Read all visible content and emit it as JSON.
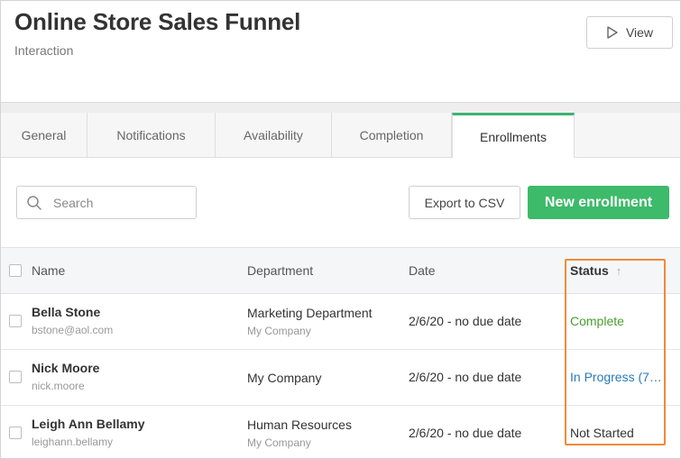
{
  "header": {
    "title": "Online Store Sales Funnel",
    "subtitle": "Interaction",
    "view_label": "View"
  },
  "tabs": [
    {
      "label": "General"
    },
    {
      "label": "Notifications"
    },
    {
      "label": "Availability"
    },
    {
      "label": "Completion"
    },
    {
      "label": "Enrollments",
      "active": true
    }
  ],
  "toolbar": {
    "search_placeholder": "Search",
    "export_label": "Export to CSV",
    "new_label": "New enrollment"
  },
  "table": {
    "columns": {
      "name": "Name",
      "department": "Department",
      "date": "Date",
      "status": "Status",
      "status_sort_arrow": "↑"
    },
    "rows": [
      {
        "name": "Bella Stone",
        "sub": "bstone@aol.com",
        "department": "Marketing Department",
        "department_sub": "My Company",
        "date": "2/6/20 - no due date",
        "status": "Complete",
        "status_color": "#4a9e2f"
      },
      {
        "name": "Nick Moore",
        "sub": "nick.moore",
        "department": "My Company",
        "department_sub": "",
        "date": "2/6/20 - no due date",
        "status": "In Progress (7…",
        "status_color": "#2a7ab8"
      },
      {
        "name": "Leigh Ann Bellamy",
        "sub": "leighann.bellamy",
        "department": "Human Resources",
        "department_sub": "My Company",
        "date": "2/6/20 - no due date",
        "status": "Not Started",
        "status_color": "#333333"
      }
    ]
  },
  "colors": {
    "accent": "#3dba6a",
    "highlight": "#ef8a3c"
  }
}
